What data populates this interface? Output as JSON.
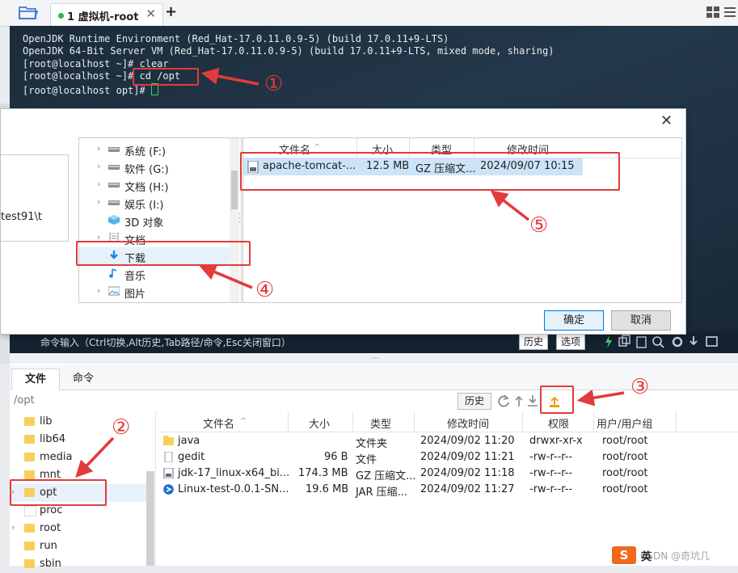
{
  "app": {
    "tab_label": "1 虚拟机-root",
    "new_tab_symbol": "+"
  },
  "terminal": {
    "lines": [
      "OpenJDK Runtime Environment (Red_Hat-17.0.11.0.9-5) (build 17.0.11+9-LTS)",
      "OpenJDK 64-Bit Server VM (Red_Hat-17.0.11.0.9-5) (build 17.0.11+9-LTS, mixed mode, sharing)",
      "[root@localhost ~]# clear",
      "[root@localhost ~]# cd /opt",
      "[root@localhost opt]# "
    ],
    "command_bar": {
      "hint": "命令输入（Ctrl切换,Alt历史,Tab路径/命令,Esc关闭窗口）",
      "history_button": "历史",
      "options_button": "选项"
    }
  },
  "dialog": {
    "close_symbol": "✕",
    "left_path_fragment": "test91\\t",
    "tree": [
      {
        "label": "系统 (F:)",
        "icon": "drive-icon",
        "has_children": true
      },
      {
        "label": "软件 (G:)",
        "icon": "drive-icon",
        "has_children": true
      },
      {
        "label": "文档 (H:)",
        "icon": "drive-icon",
        "has_children": true
      },
      {
        "label": "娱乐 (I:)",
        "icon": "drive-icon",
        "has_children": true
      },
      {
        "label": "3D 对象",
        "icon": "3d-objects-icon",
        "has_children": false
      },
      {
        "label": "文档",
        "icon": "documents-icon",
        "has_children": true
      },
      {
        "label": "下载",
        "icon": "download-icon",
        "has_children": false,
        "selected": true
      },
      {
        "label": "音乐",
        "icon": "music-icon",
        "has_children": false
      },
      {
        "label": "图片",
        "icon": "pictures-icon",
        "has_children": true
      }
    ],
    "columns": [
      "文件名",
      "大小",
      "类型",
      "修改时间"
    ],
    "files": [
      {
        "name": "apache-tomcat-...",
        "size": "12.5 MB",
        "type": "GZ 压缩文...",
        "modified": "2024/09/07 10:15"
      }
    ],
    "ok_button": "确定",
    "cancel_button": "取消"
  },
  "lower": {
    "tabs": [
      "文件",
      "命令"
    ],
    "path": "/opt",
    "history_button": "历史",
    "tree": [
      {
        "label": "lib",
        "expandable": false
      },
      {
        "label": "lib64",
        "expandable": false
      },
      {
        "label": "media",
        "expandable": false
      },
      {
        "label": "mnt",
        "expandable": false
      },
      {
        "label": "opt",
        "expandable": true,
        "selected": true
      },
      {
        "label": "proc",
        "expandable": false,
        "open": true
      },
      {
        "label": "root",
        "expandable": true
      },
      {
        "label": "run",
        "expandable": false
      },
      {
        "label": "sbin",
        "expandable": false
      }
    ],
    "columns": [
      "文件名",
      "大小",
      "类型",
      "修改时间",
      "权限",
      "用户/用户组"
    ],
    "files": [
      {
        "name": "java",
        "size": "",
        "type": "文件夹",
        "modified": "2024/09/02 11:20",
        "perm": "drwxr-xr-x",
        "owner": "root/root",
        "icon": "folder-icon"
      },
      {
        "name": "gedit",
        "size": "96 B",
        "type": "文件",
        "modified": "2024/09/02 11:21",
        "perm": "-rw-r--r--",
        "owner": "root/root",
        "icon": "file-icon"
      },
      {
        "name": "jdk-17_linux-x64_bi...",
        "size": "174.3 MB",
        "type": "GZ 压缩文...",
        "modified": "2024/09/02 11:18",
        "perm": "-rw-r--r--",
        "owner": "root/root",
        "icon": "gz-archive-icon"
      },
      {
        "name": "Linux-test-0.0.1-SN...",
        "size": "19.6 MB",
        "type": "JAR 压缩...",
        "modified": "2024/09/02 11:27",
        "perm": "-rw-r--r--",
        "owner": "root/root",
        "icon": "jar-icon"
      }
    ]
  },
  "annotations": [
    "①",
    "②",
    "③",
    "④",
    "⑤"
  ],
  "ime": {
    "logo": "S",
    "mode": "英"
  },
  "watermark": "CSDN @奇坑几",
  "colors": {
    "annotation_red": "#e23b3b",
    "selection_blue": "#cce4f7",
    "folder_yellow": "#f7cf5b",
    "cursor_green": "#3fd06a"
  }
}
